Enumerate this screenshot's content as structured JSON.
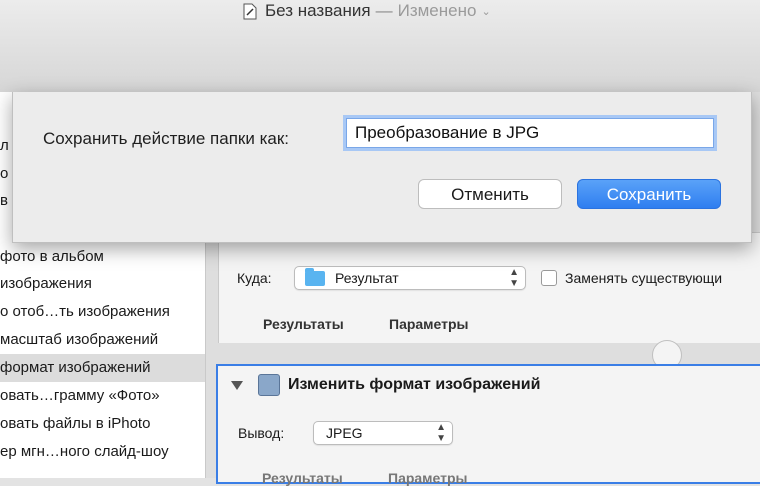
{
  "window": {
    "title": "Без названия",
    "separator": "—",
    "status": "Изменено",
    "chevron": "⌄"
  },
  "sidebar": {
    "items": [
      {
        "label": "л"
      },
      {
        "label": "о"
      },
      {
        "label": "в"
      },
      {
        "label": "фото в альбом"
      },
      {
        "label": "изображения"
      },
      {
        "label": "о отоб…ть изображения"
      },
      {
        "label": "масштаб изображений"
      },
      {
        "label": "формат изображений",
        "selected": true
      },
      {
        "label": "овать…грамму «Фото»"
      },
      {
        "label": "овать файлы в iPhoto"
      },
      {
        "label": "ер мгн…ного слайд-шоу"
      }
    ]
  },
  "action1": {
    "where_label": "Куда:",
    "where_value": "Результат",
    "replace_label": "Заменять существующи",
    "tab_results": "Результаты",
    "tab_params": "Параметры"
  },
  "action2": {
    "title": "Изменить формат изображений",
    "output_label": "Вывод:",
    "output_value": "JPEG",
    "tab_results": "Результаты",
    "tab_params": "Параметры"
  },
  "dialog": {
    "label": "Сохранить действие папки как:",
    "input_value": "Преобразование в JPG",
    "cancel_label": "Отменить",
    "save_label": "Сохранить",
    "accent_color": "#2f7ef0"
  }
}
